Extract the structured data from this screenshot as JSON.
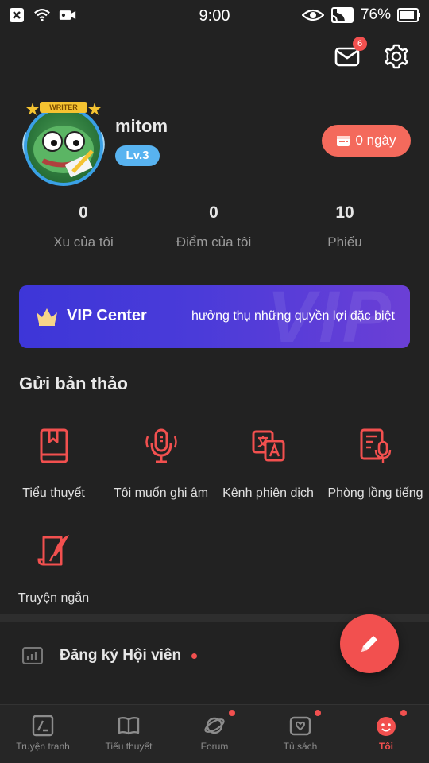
{
  "status_bar": {
    "time": "9:00",
    "battery_percent": "76%",
    "icons": [
      "close-box-icon",
      "wifi-icon",
      "video-icon",
      "eye-icon",
      "cast-icon",
      "battery-icon"
    ]
  },
  "header": {
    "mail_badge": "6",
    "icons": [
      "mail-icon",
      "gear-icon"
    ]
  },
  "profile": {
    "avatar_tag": "WRITER",
    "username": "mitom",
    "level": "Lv.3",
    "checkin_label": "0 ngày"
  },
  "stats": [
    {
      "value": "0",
      "label": "Xu của tôi"
    },
    {
      "value": "0",
      "label": "Điểm của tôi"
    },
    {
      "value": "10",
      "label": "Phiếu"
    }
  ],
  "vip": {
    "watermark": "VIP",
    "title": "VIP Center",
    "description": "hưởng thụ những quyền lợi đặc biệt"
  },
  "submit_section": {
    "title": "Gửi bản thảo",
    "items": [
      {
        "label": "Tiểu thuyết",
        "icon": "book-icon"
      },
      {
        "label": "Tôi muốn ghi âm",
        "icon": "microphone-icon"
      },
      {
        "label": "Kênh phiên dịch",
        "icon": "translate-icon"
      },
      {
        "label": "Phòng lồng tiếng",
        "icon": "dubbing-icon"
      },
      {
        "label": "Truyện ngắn",
        "icon": "quill-icon"
      }
    ]
  },
  "membership": {
    "label": "Đăng ký Hội viên"
  },
  "bottom_nav": [
    {
      "label": "Truyện tranh",
      "icon": "comic-icon"
    },
    {
      "label": "Tiểu thuyết",
      "icon": "open-book-icon"
    },
    {
      "label": "Forum",
      "icon": "planet-icon"
    },
    {
      "label": "Tủ sách",
      "icon": "bookshelf-icon"
    },
    {
      "label": "Tôi",
      "icon": "smiley-icon"
    }
  ],
  "colors": {
    "background": "#222222",
    "accent": "#f2504f",
    "vip_gradient_start": "#3d36d8",
    "level_badge": "#58b3f0"
  }
}
